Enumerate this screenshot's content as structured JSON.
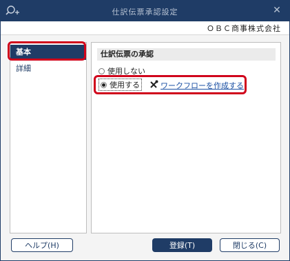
{
  "window": {
    "title": "仕訳伝票承認設定",
    "close_icon": "close-icon",
    "app_icon": "search-plus-icon"
  },
  "company": {
    "name": "ＯＢＣ商事株式会社"
  },
  "nav": {
    "items": [
      {
        "label": "基本",
        "selected": true
      },
      {
        "label": "詳細",
        "selected": false
      }
    ]
  },
  "content": {
    "section_title": "仕訳伝票の承認",
    "options": [
      {
        "label": "使用しない",
        "checked": false
      },
      {
        "label": "使用する",
        "checked": true
      }
    ],
    "workflow_link": {
      "icon": "tools-icon",
      "label": "ワークフローを作成する"
    }
  },
  "buttons": {
    "help": "ヘルプ(H)",
    "register": "登録(T)",
    "close": "閉じる(C)"
  },
  "colors": {
    "titlebar": "#1f3c66",
    "highlight": "#d0021b",
    "link": "#1a4fa3"
  }
}
